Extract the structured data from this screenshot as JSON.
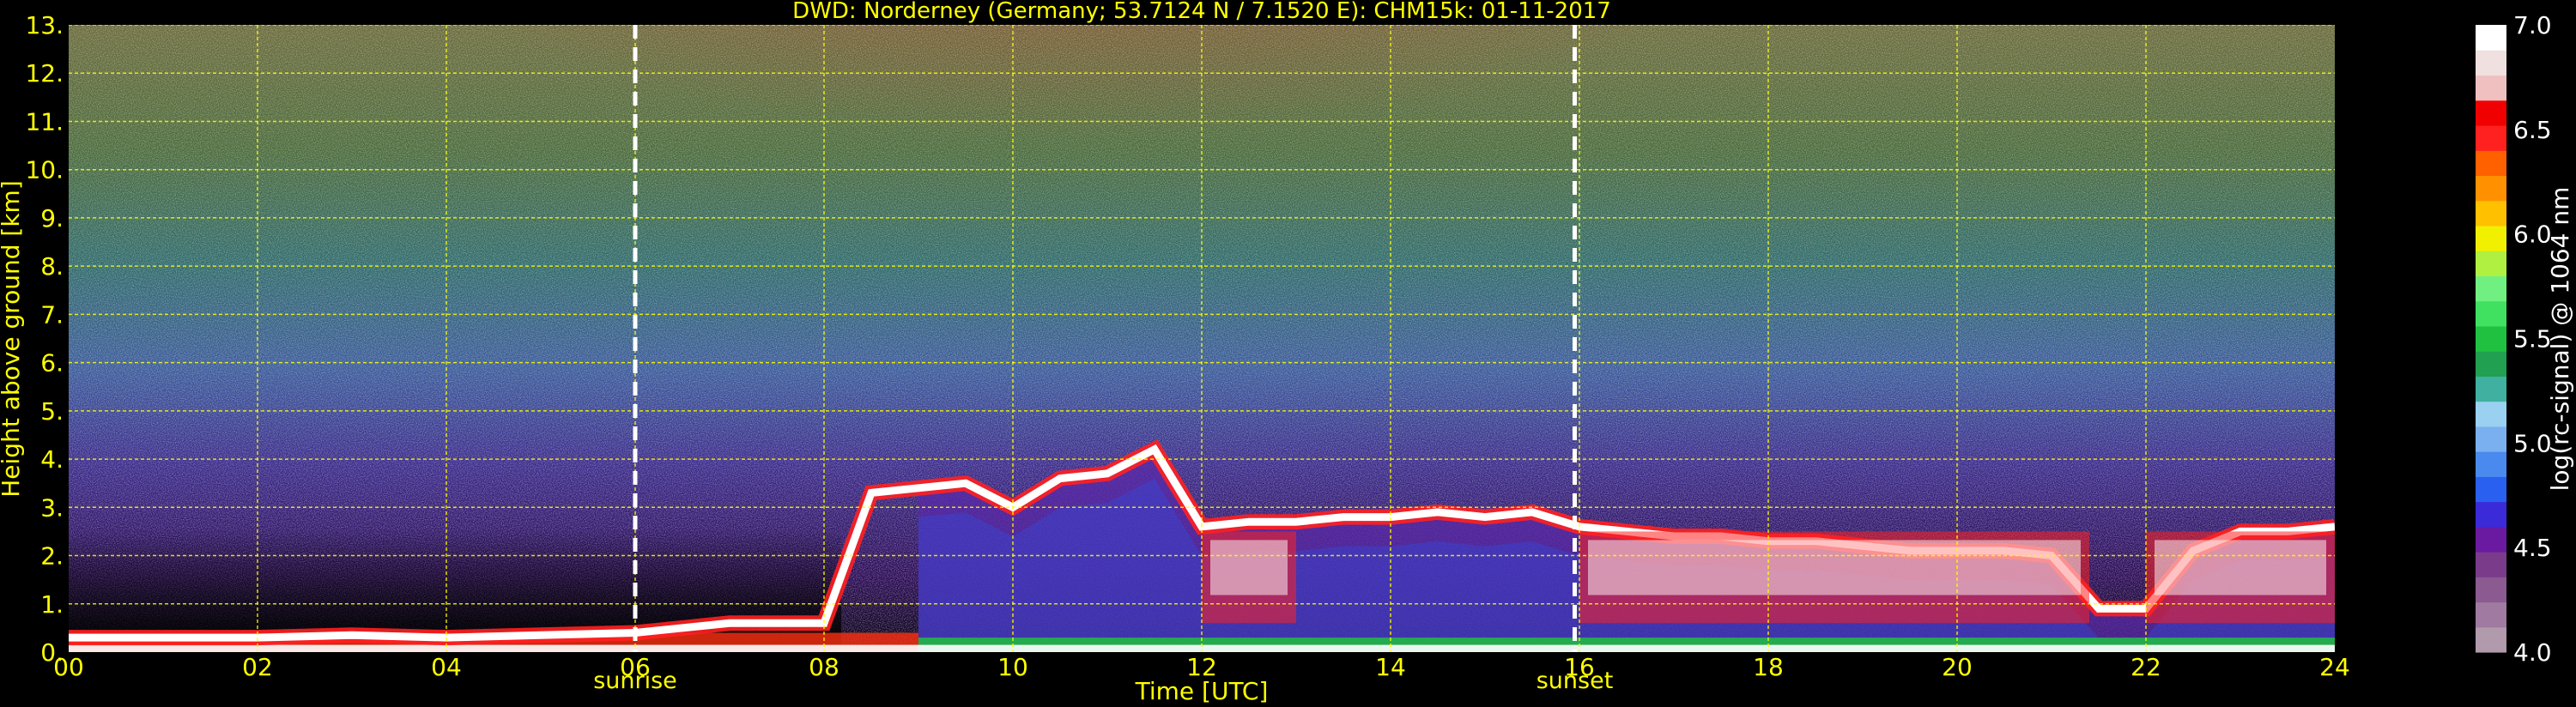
{
  "chart_data": {
    "type": "heatmap",
    "title": "DWD: Norderney (Germany; 53.7124 N / 7.1520 E):    CHM15k: 01-11-2017",
    "xlabel": "Time [UTC]",
    "ylabel": "Height above ground [km]",
    "xlim": [
      0,
      24
    ],
    "ylim": [
      0,
      13
    ],
    "x_ticks": [
      "00",
      "02",
      "04",
      "06",
      "08",
      "10",
      "12",
      "14",
      "16",
      "18",
      "20",
      "22",
      "24"
    ],
    "y_ticks": [
      "0.",
      "1.",
      "2.",
      "3.",
      "4.",
      "5.",
      "6.",
      "7.",
      "8.",
      "9.",
      "10.",
      "11.",
      "12.",
      "13."
    ],
    "grid": true,
    "annotations": [
      {
        "x": 6.0,
        "label": "sunrise"
      },
      {
        "x": 15.95,
        "label": "sunset"
      }
    ],
    "colorbar": {
      "label": "log(rc-signal) @ 1064 nm",
      "range": [
        4.0,
        7.0
      ],
      "ticks": [
        "4.0",
        "4.5",
        "5.0",
        "5.5",
        "6.0",
        "6.5",
        "7.0"
      ],
      "colors": [
        "#b09aac",
        "#a07aa0",
        "#8a5a90",
        "#7a3c8a",
        "#6a1aa0",
        "#3a2ad8",
        "#2a60f0",
        "#4a8aee",
        "#7ab0f0",
        "#9ad0f0",
        "#40b0a0",
        "#20a050",
        "#20c040",
        "#40e060",
        "#70f080",
        "#b0f040",
        "#f0f000",
        "#ffc000",
        "#ff9000",
        "#ff6000",
        "#ff2020",
        "#f00000",
        "#f0c0c0",
        "#f0e0e0",
        "#ffffff"
      ]
    },
    "series": [
      {
        "name": "cloud_base",
        "x": [
          0,
          1,
          2,
          3,
          4,
          5,
          6,
          7,
          8,
          8.5,
          9,
          9.5,
          10,
          10.5,
          11,
          11.5,
          12,
          12.5,
          13,
          13.5,
          14,
          14.5,
          15,
          15.5,
          16,
          16.5,
          17,
          17.5,
          18,
          18.5,
          19,
          19.5,
          20,
          20.5,
          21,
          21.5,
          22,
          22.5,
          23,
          23.5,
          24
        ],
        "y": [
          0.3,
          0.3,
          0.3,
          0.35,
          0.3,
          0.35,
          0.4,
          0.6,
          0.6,
          3.3,
          3.4,
          3.5,
          3.0,
          3.6,
          3.7,
          4.2,
          2.6,
          2.7,
          2.7,
          2.8,
          2.8,
          2.9,
          2.8,
          2.9,
          2.6,
          2.5,
          2.4,
          2.4,
          2.3,
          2.3,
          2.2,
          2.1,
          2.1,
          2.1,
          2.0,
          0.9,
          0.9,
          2.1,
          2.5,
          2.5,
          2.6
        ]
      }
    ]
  }
}
